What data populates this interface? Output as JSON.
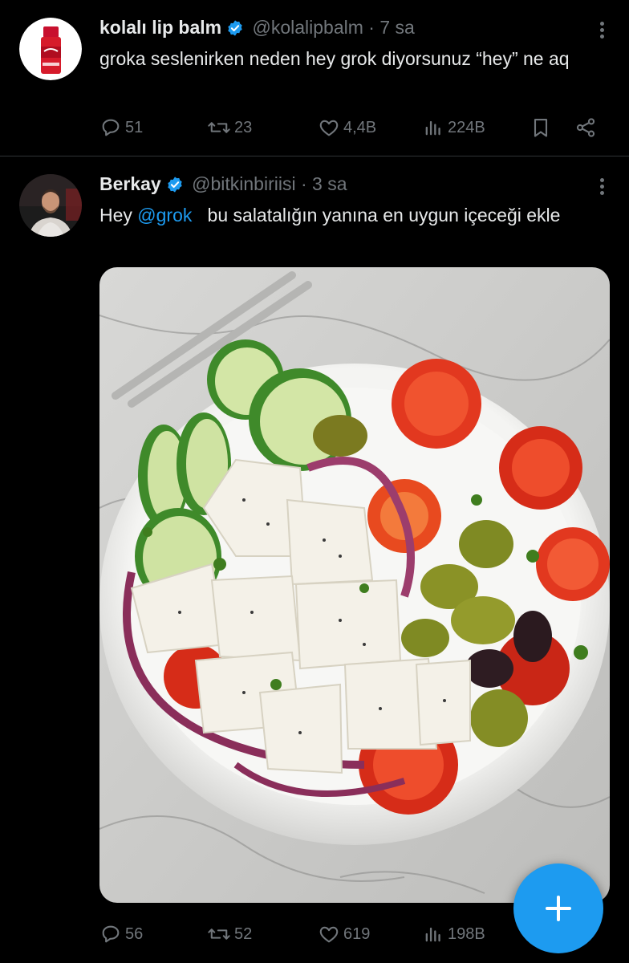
{
  "tweets": [
    {
      "name": "kolalı lip balm",
      "handle": "@kolalipbalm",
      "dot": "·",
      "time": "7 sa",
      "text": "groka seslenirken neden hey grok diyorsunuz “hey” ne aq",
      "actions": {
        "replies": "51",
        "reposts": "23",
        "likes": "4,4B",
        "views": "224B"
      }
    },
    {
      "name": "Berkay",
      "handle": "@bitkinbiriisi",
      "dot": "·",
      "time": "3 sa",
      "text_prefix": "Hey ",
      "mention": "@grok",
      "text_suffix": "   bu salatalığın yanına en uygun içeceği ekle",
      "actions": {
        "replies": "56",
        "reposts": "52",
        "likes": "619",
        "views": "198B"
      }
    }
  ],
  "colors": {
    "accent": "#1d9bf0",
    "muted": "#71767b",
    "text": "#e7e9ea",
    "background": "#000000"
  },
  "icons": {
    "reply": "speech-bubble-icon",
    "repost": "repost-arrows-icon",
    "like": "heart-icon",
    "views": "bar-chart-icon",
    "bookmark": "bookmark-icon",
    "share": "share-icon",
    "verified": "verified-badge-icon",
    "more": "more-dots-icon",
    "compose": "plus-icon"
  }
}
